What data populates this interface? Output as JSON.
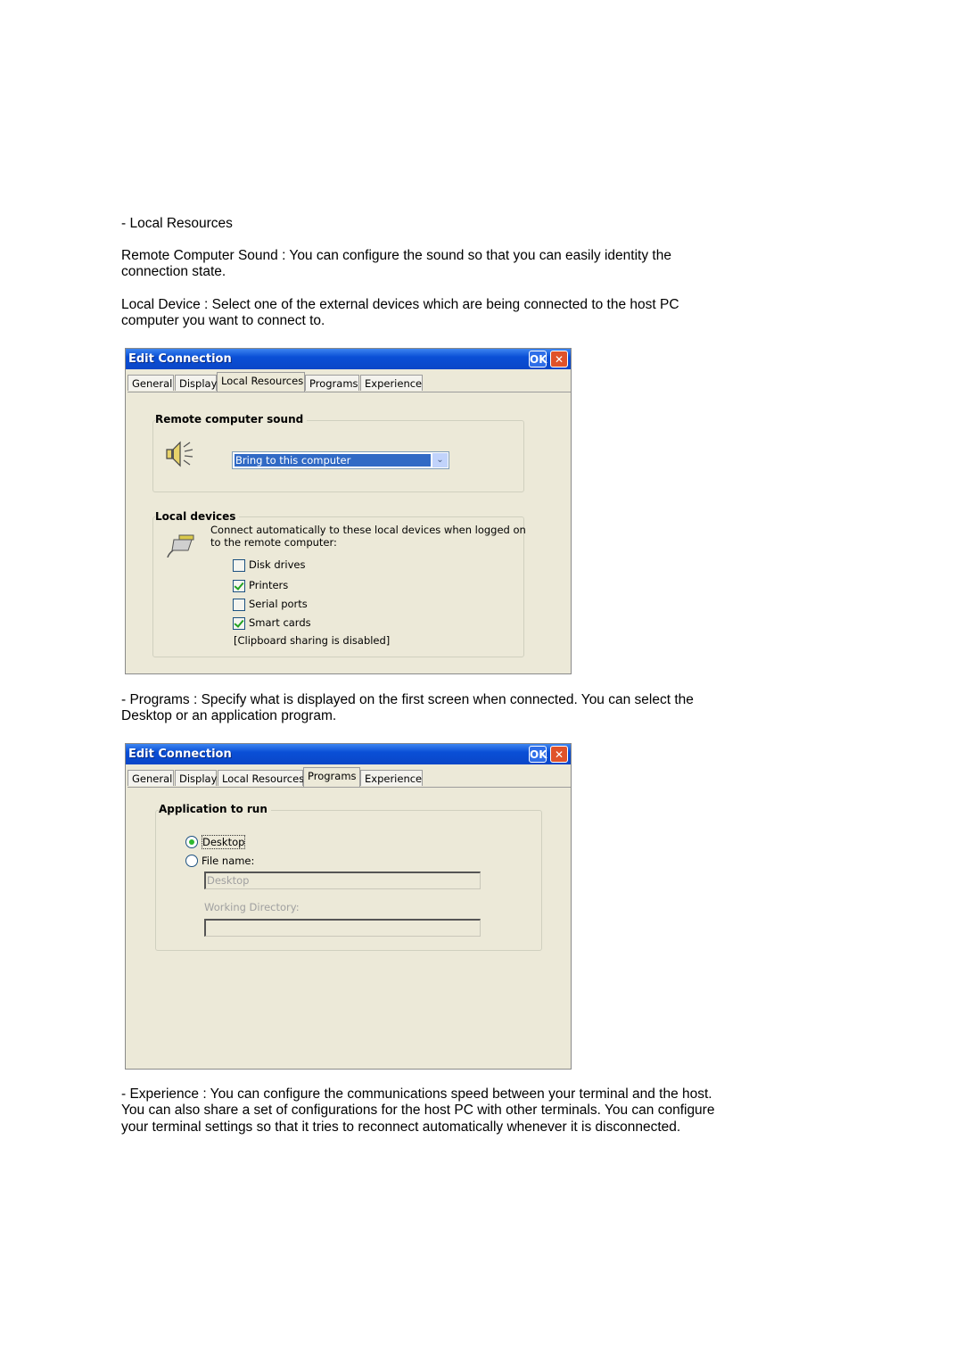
{
  "paragraphs": {
    "local_resources_heading": "- Local Resources",
    "remote_sound": "Remote Computer Sound : You can configure the sound so that you can easily identity the connection state.",
    "local_device": "Local Device : Select one of the external devices which are being connected to the host PC computer you want to connect to.",
    "programs": "- Programs : Specify what is displayed on the first screen when connected. You can select the Desktop or an application program.",
    "experience": "- Experience : You can configure the communications speed between your terminal and the host. You can also share a set of configurations for the host PC with other terminals. You can configure your terminal settings so that it tries to reconnect automatically whenever it is disconnected."
  },
  "dialog": {
    "title": "Edit Connection",
    "ok_label": "OK",
    "close_label": "✕",
    "tabs": [
      "General",
      "Display",
      "Local Resources",
      "Programs",
      "Experience"
    ]
  },
  "local_resources_dialog": {
    "active_tab": "Local Resources",
    "sound_group": {
      "label": "Remote computer sound",
      "combo_value": "Bring to this computer",
      "icon": "speaker-icon"
    },
    "devices_group": {
      "label": "Local devices",
      "icon": "plug-icon",
      "description_line1": "Connect automatically to these local devices when logged on",
      "description_line2": "to the remote computer:",
      "checkboxes": [
        {
          "label": "Disk drives",
          "checked": false
        },
        {
          "label": "Printers",
          "checked": true
        },
        {
          "label": "Serial ports",
          "checked": false
        },
        {
          "label": "Smart cards",
          "checked": true
        }
      ],
      "clipboard_note": "[Clipboard sharing is disabled]"
    }
  },
  "programs_dialog": {
    "active_tab": "Programs",
    "group_label": "Application to run",
    "radios": [
      {
        "label": "Desktop",
        "selected": true
      },
      {
        "label": "File name:",
        "selected": false
      }
    ],
    "file_name_value": "Desktop",
    "working_directory_label": "Working Directory:",
    "working_directory_value": ""
  },
  "colors": {
    "titlebar": "#0a4fd6",
    "dialog_bg": "#ece9d8",
    "selection": "#316ac5"
  }
}
